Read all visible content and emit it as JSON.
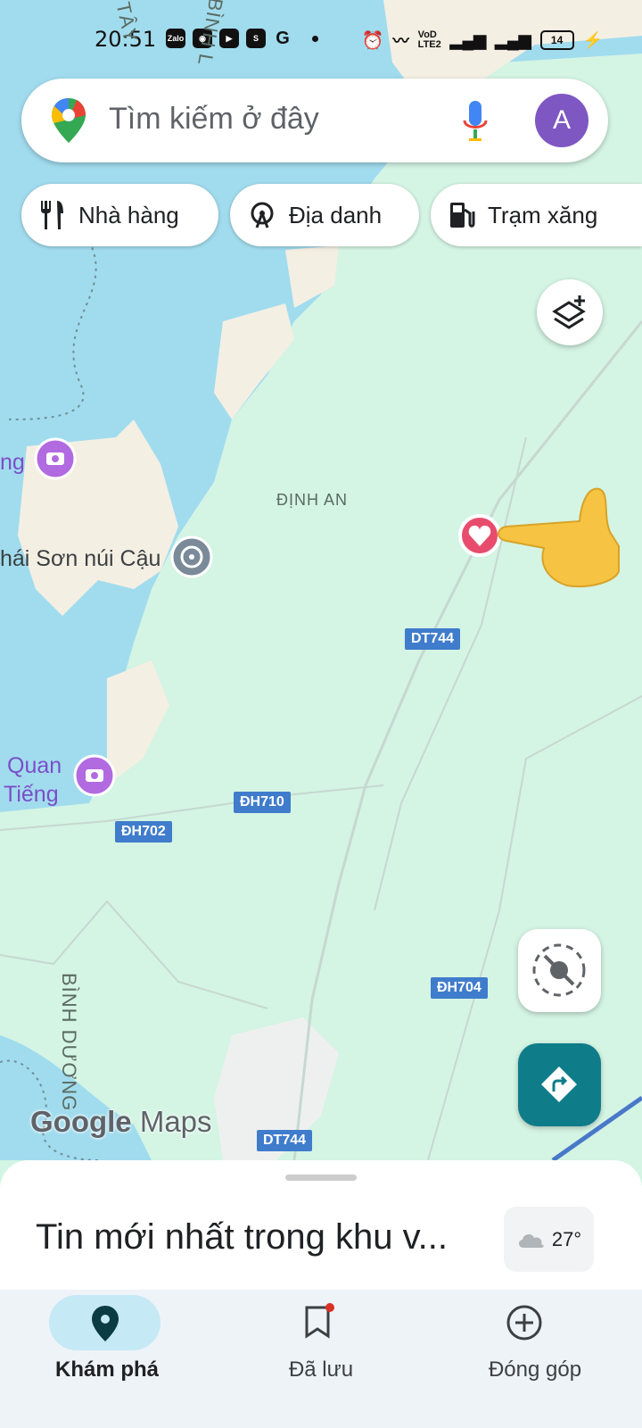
{
  "status_bar": {
    "time": "20:51",
    "app_icons": [
      "Zalo",
      "discord-icon",
      "youtube-icon",
      "shopee-icon",
      "G"
    ],
    "network_label": "VoD LTE2",
    "battery": "14"
  },
  "search": {
    "placeholder": "Tìm kiếm ở đây",
    "avatar_letter": "A"
  },
  "chips": [
    {
      "label": "Nhà hàng",
      "icon": "restaurant-icon"
    },
    {
      "label": "Địa danh",
      "icon": "attraction-icon"
    },
    {
      "label": "Trạm xăng",
      "icon": "gas-station-icon"
    }
  ],
  "map": {
    "labels": {
      "dinh_an": "ĐỊNH AN",
      "binh_duong": "BÌNH DƯƠNG",
      "tay": "TÂY",
      "binh_top": "BÌNH L"
    },
    "pois": {
      "left_top": "ng",
      "thai_son": "hái Sơn núi Cậu",
      "quan_line1": "Quan",
      "quan_line2": "Tiếng"
    },
    "roads": [
      "DT744",
      "ĐH710",
      "ĐH702",
      "ĐH704",
      "DT744"
    ],
    "watermark_google": "Google",
    "watermark_maps": "Maps"
  },
  "sheet": {
    "title": "Tin mới nhất trong khu v...",
    "temperature": "27°"
  },
  "nav": {
    "items": [
      {
        "label": "Khám phá",
        "icon": "explore-pin-icon",
        "active": true
      },
      {
        "label": "Đã lưu",
        "icon": "bookmark-icon",
        "active": false
      },
      {
        "label": "Đóng góp",
        "icon": "add-circle-icon",
        "active": false
      }
    ]
  },
  "colors": {
    "water": "#a1dcee",
    "land": "#d4f4e4",
    "sand": "#f4efe3",
    "accent": "#0f7c8a",
    "poi_purple": "#b26ae0",
    "road_label": "#3f7ccc",
    "heart": "#e84c6c"
  }
}
